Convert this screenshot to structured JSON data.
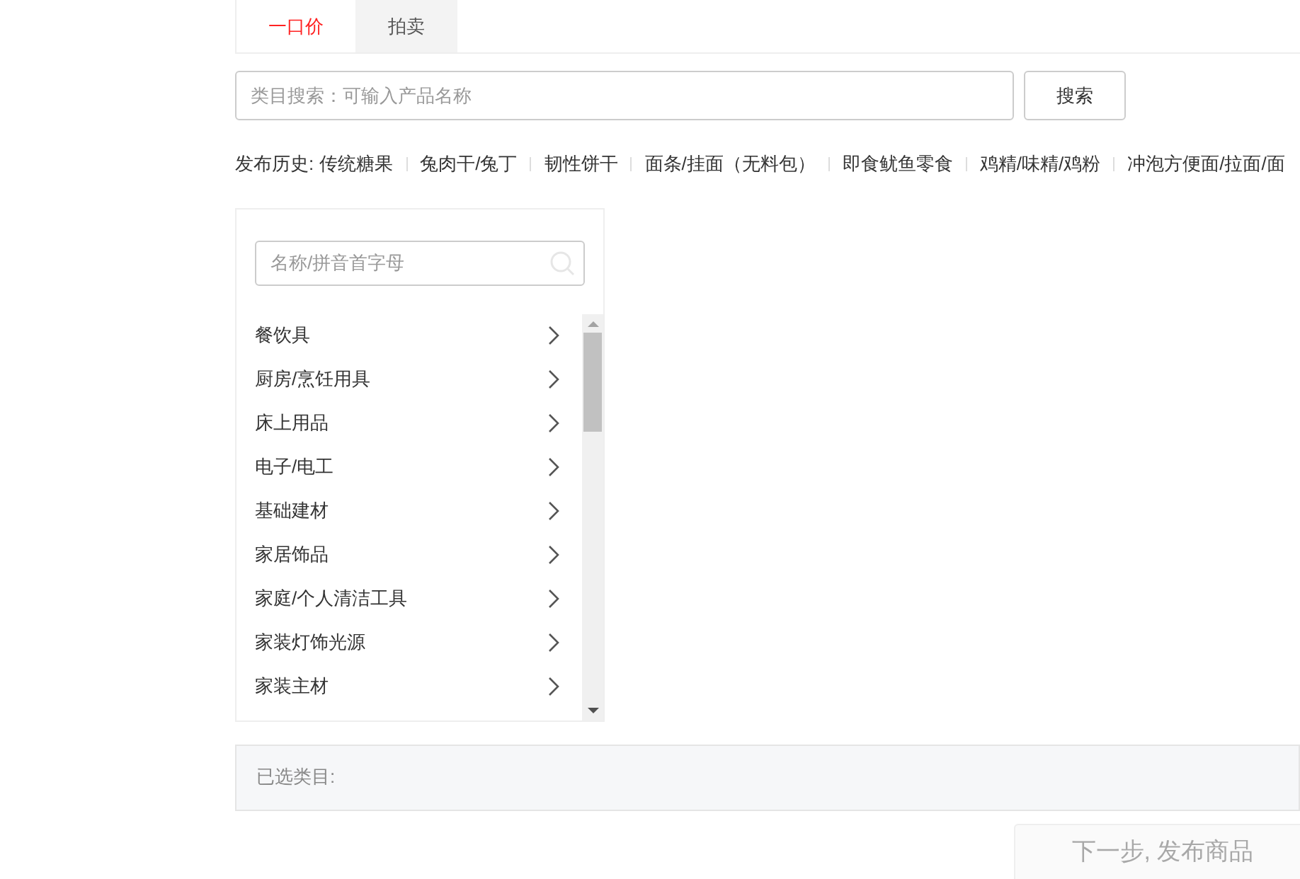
{
  "tabs": [
    {
      "label": "一口价",
      "selected": true
    },
    {
      "label": "拍卖",
      "selected": false
    }
  ],
  "category_search": {
    "placeholder": "类目搜索：可输入产品名称",
    "button": "搜索"
  },
  "history": {
    "label": "发布历史:",
    "items": [
      "传统糖果",
      "兔肉干/兔丁",
      "韧性饼干",
      "面条/挂面（无料包）",
      "即食鱿鱼零食",
      "鸡精/味精/鸡粉",
      "冲泡方便面/拉面/面"
    ]
  },
  "category_panel": {
    "filter_placeholder": "名称/拼音首字母",
    "items": [
      "餐饮具",
      "厨房/烹饪用具",
      "床上用品",
      "电子/电工",
      "基础建材",
      "家居饰品",
      "家庭/个人清洁工具",
      "家装灯饰光源",
      "家装主材"
    ]
  },
  "selected_bar": {
    "label": "已选类目:"
  },
  "next_button": {
    "label": "下一步, 发布商品",
    "disabled": true
  }
}
